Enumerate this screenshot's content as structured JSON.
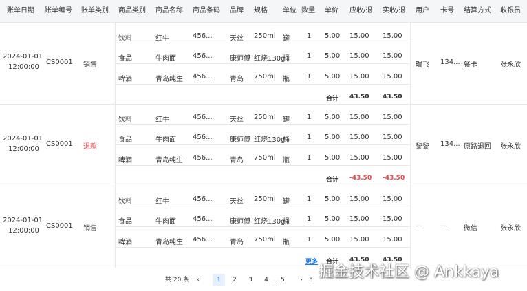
{
  "columns": [
    "账单日期",
    "账单编号",
    "账单类别",
    "商品类别",
    "商品名称",
    "商品条码",
    "品牌",
    "规格",
    "单位",
    "数量",
    "单价",
    "应收/退",
    "实收/退",
    "用户",
    "卡号",
    "结算方式",
    "收银员"
  ],
  "bills": [
    {
      "date_line1": "2024-01-01",
      "date_line2": "12:00:00",
      "bill_no": "CS0001",
      "category": "销售",
      "category_color": "#333333",
      "items": [
        {
          "cat": "饮料",
          "name": "红牛",
          "barcode": "456...",
          "brand": "天丝",
          "spec": "250ml",
          "unit": "罐",
          "qty": "1",
          "price": "5.00",
          "due": "15.00",
          "paid": "15.00"
        },
        {
          "cat": "食品",
          "name": "牛肉面",
          "barcode": "456...",
          "brand": "康师傅",
          "spec": "红烧130g",
          "unit": "桶",
          "qty": "1",
          "price": "5.00",
          "due": "15.00",
          "paid": "15.00"
        },
        {
          "cat": "啤酒",
          "name": "青岛纯生",
          "barcode": "456...",
          "brand": "青岛",
          "spec": "750ml",
          "unit": "瓶",
          "qty": "1",
          "price": "5.00",
          "due": "15.00",
          "paid": "15.00"
        }
      ],
      "more": "",
      "total_label": "合计",
      "total_due": "43.50",
      "total_paid": "43.50",
      "user": "瑞飞",
      "card": "134...",
      "settle": "餐卡",
      "cashier": "张永欣"
    },
    {
      "date_line1": "2024-01-01",
      "date_line2": "12:00:00",
      "bill_no": "CS0001",
      "category": "退款",
      "category_color": "#e5484d",
      "items": [
        {
          "cat": "饮料",
          "name": "红牛",
          "barcode": "456...",
          "brand": "天丝",
          "spec": "250ml",
          "unit": "罐",
          "qty": "1",
          "price": "5.00",
          "due": "15.00",
          "paid": "15.00"
        },
        {
          "cat": "食品",
          "name": "牛肉面",
          "barcode": "456...",
          "brand": "康师傅",
          "spec": "红烧130g",
          "unit": "桶",
          "qty": "1",
          "price": "5.00",
          "due": "15.00",
          "paid": "15.00"
        },
        {
          "cat": "啤酒",
          "name": "青岛纯生",
          "barcode": "456...",
          "brand": "青岛",
          "spec": "750ml",
          "unit": "瓶",
          "qty": "1",
          "price": "5.00",
          "due": "15.00",
          "paid": "15.00"
        }
      ],
      "more": "",
      "total_label": "合计",
      "total_due": "-43.50",
      "total_paid": "-43.50",
      "user": "黎黎",
      "card": "134...",
      "settle": "原路退回",
      "cashier": "张永欣"
    },
    {
      "date_line1": "2024-01-01",
      "date_line2": "12:00:00",
      "bill_no": "CS0001",
      "category": "销售",
      "category_color": "#333333",
      "items": [
        {
          "cat": "饮料",
          "name": "红牛",
          "barcode": "456...",
          "brand": "天丝",
          "spec": "250ml",
          "unit": "罐",
          "qty": "1",
          "price": "5.00",
          "due": "15.00",
          "paid": "15.00"
        },
        {
          "cat": "食品",
          "name": "牛肉面",
          "barcode": "456...",
          "brand": "康师傅",
          "spec": "红烧130g",
          "unit": "桶",
          "qty": "1",
          "price": "5.00",
          "due": "15.00",
          "paid": "15.00"
        },
        {
          "cat": "啤酒",
          "name": "青岛纯生",
          "barcode": "456...",
          "brand": "青岛",
          "spec": "750ml",
          "unit": "瓶",
          "qty": "1",
          "price": "5.00",
          "due": "15.00",
          "paid": "15.00"
        }
      ],
      "more": "更多",
      "total_label": "合计",
      "total_due": "43.50",
      "total_paid": "43.50",
      "user": "—",
      "card": "—",
      "settle": "微信",
      "cashier": "张永欣"
    }
  ],
  "pagination": {
    "total_text": "共 20 条",
    "prev_icon": "‹",
    "next_icon": "›",
    "pages": [
      "1",
      "2",
      "3",
      "4",
      "…",
      "5"
    ],
    "active_page": "1",
    "last_page": "5"
  },
  "watermark": "掘金技术社区 @ Ankkaya"
}
